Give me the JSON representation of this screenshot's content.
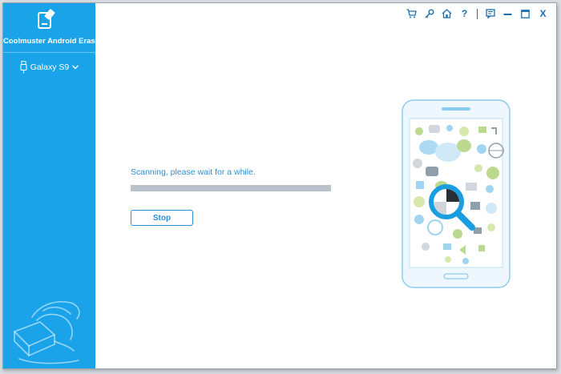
{
  "app": {
    "title": "Coolmuster Android Eraser"
  },
  "sidebar": {
    "device": {
      "name": "Galaxy S9",
      "icon": "usb-icon",
      "dropdown_icon": "chevron-down-icon"
    }
  },
  "titlebar": {
    "icons": [
      "cart-icon",
      "key-icon",
      "home-icon",
      "help-icon",
      "feedback-icon",
      "minimize-icon",
      "maximize-icon",
      "close-icon"
    ],
    "help_label": "?",
    "close_label": "X"
  },
  "main": {
    "status_text": "Scanning, please wait for a while.",
    "progress": 1.0,
    "stop_label": "Stop"
  },
  "colors": {
    "sidebar": "#1aa3e8",
    "accent": "#2a8fd6",
    "progress_fill": "#b9c1cb",
    "titlebar_icon": "#1a6fb0"
  }
}
